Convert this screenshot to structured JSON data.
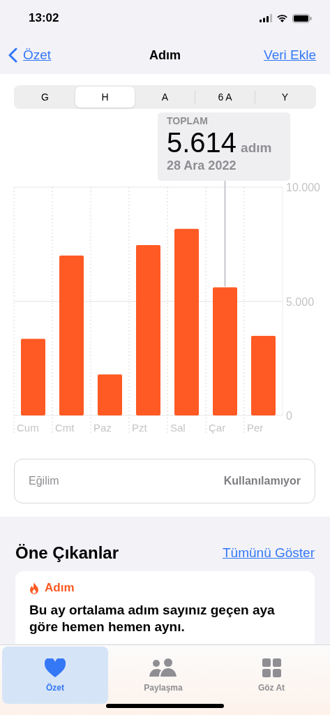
{
  "status_bar": {
    "time": "13:02"
  },
  "nav": {
    "back": "Özet",
    "title": "Adım",
    "action": "Veri Ekle"
  },
  "segments": [
    {
      "label": "G",
      "selected": false
    },
    {
      "label": "H",
      "selected": true
    },
    {
      "label": "A",
      "selected": false
    },
    {
      "label": "6 A",
      "selected": false
    },
    {
      "label": "Y",
      "selected": false
    }
  ],
  "summary": {
    "label": "TOPLAM",
    "value": "5.614",
    "unit": "adım",
    "date": "28 Ara 2022"
  },
  "chart_data": {
    "type": "bar",
    "categories": [
      "Cum",
      "Cmt",
      "Paz",
      "Pzt",
      "Sal",
      "Çar",
      "Per"
    ],
    "series": [
      {
        "color": "#ff5a23",
        "values": [
          3360,
          7000,
          1800,
          7460,
          8170,
          5614,
          3490
        ]
      }
    ],
    "annotations": [
      {
        "x": "Çar"
      }
    ],
    "ylim": [
      0,
      10000
    ],
    "yticks": [
      {
        "value": 0,
        "label": "0"
      },
      {
        "value": 5000,
        "label": "5.000"
      },
      {
        "value": 10000,
        "label": "10.000"
      }
    ]
  },
  "trend": {
    "label": "Eğilim",
    "value": "Kullanılamıyor"
  },
  "highlights": {
    "title": "Öne Çıkanlar",
    "link": "Tümünü Göster",
    "card": {
      "category": "Adım",
      "text": "Bu ay ortalama adım sayınız geçen aya göre hemen hemen aynı."
    }
  },
  "tab_bar": [
    {
      "label": "Özet",
      "selected": true
    },
    {
      "label": "Paylaşma",
      "selected": false
    },
    {
      "label": "Göz At",
      "selected": false
    }
  ]
}
